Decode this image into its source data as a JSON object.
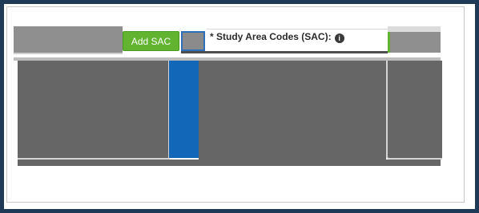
{
  "toolbar": {
    "add_sac_label": "Add SAC"
  },
  "field": {
    "label": "* Study Area Codes (SAC):",
    "info_icon_glyph": "i"
  },
  "colors": {
    "frame_border": "#1f3a57",
    "add_button_bg": "#62b32f",
    "selected_column": "#1367b8",
    "panel_gray": "#666666"
  }
}
